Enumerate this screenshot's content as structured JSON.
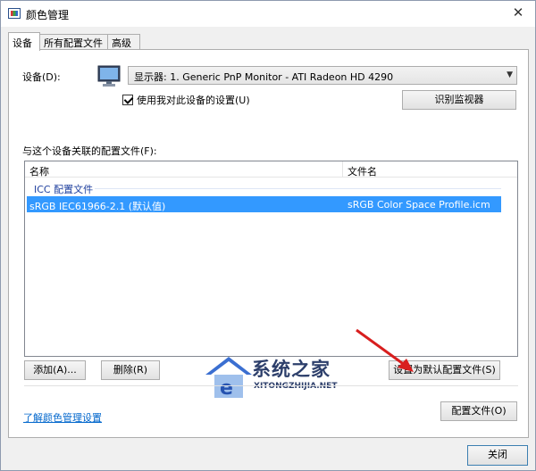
{
  "window": {
    "title": "颜色管理",
    "close_glyph": "✕"
  },
  "tabs": [
    {
      "label": "设备"
    },
    {
      "label": "所有配置文件"
    },
    {
      "label": "高级"
    }
  ],
  "device": {
    "label": "设备(D):",
    "selected": "显示器: 1. Generic PnP Monitor - ATI Radeon HD 4290",
    "use_my_settings_label": "使用我对此设备的设置(U)",
    "identify_button": "识别监视器"
  },
  "profiles": {
    "section_label": "与这个设备关联的配置文件(F):",
    "columns": [
      "名称",
      "文件名"
    ],
    "group_label": "ICC 配置文件",
    "rows": [
      {
        "name": "sRGB IEC61966-2.1 (默认值)",
        "filename": "sRGB Color Space Profile.icm"
      }
    ],
    "add_button": "添加(A)...",
    "remove_button": "删除(R)",
    "set_default_button": "设置为默认配置文件(S)"
  },
  "watermark": {
    "title": "系统之家",
    "subtitle": "XITONGZHIJIA.NET"
  },
  "footer": {
    "learn_link": "了解颜色管理设置",
    "profile_button": "配置文件(O)",
    "close_button": "关闭"
  },
  "colors": {
    "accent_selection": "#3399ff",
    "link": "#0066cc",
    "arrow": "#d81e1e"
  }
}
